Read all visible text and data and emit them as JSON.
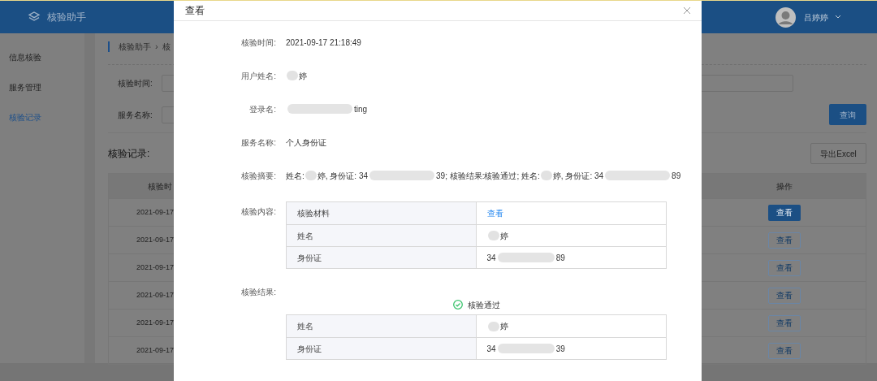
{
  "app": {
    "title": "核验助手",
    "user": "吕婷婷",
    "sidebar": [
      {
        "label": "信息核验",
        "selected": false
      },
      {
        "label": "服务管理",
        "selected": false
      },
      {
        "label": "核验记录",
        "selected": true
      }
    ],
    "breadcrumb": [
      "核验助手",
      "核"
    ],
    "breadcrumb_separator": "›",
    "filters": [
      {
        "label": "核验时间:"
      },
      {
        "label": "服务名称:"
      }
    ],
    "query_button": "查询",
    "records_title": "核验记录:",
    "export_button": "导出Excel",
    "table": {
      "columns": [
        "核验时",
        "操作"
      ],
      "rows": [
        {
          "date": "2021-09-17",
          "action": "查看",
          "selected": true
        },
        {
          "date": "2021-09-17",
          "action": "查看",
          "selected": false
        },
        {
          "date": "2021-09-17",
          "action": "查看",
          "selected": false
        },
        {
          "date": "2021-09-17",
          "action": "查看",
          "selected": false
        },
        {
          "date": "2021-09-17",
          "action": "查看",
          "selected": false
        },
        {
          "date": "2021-09-17",
          "action": "查看",
          "selected": false
        }
      ]
    }
  },
  "dialog": {
    "title": "查看",
    "fields": [
      {
        "label": "核验时间:",
        "value": [
          {
            "kind": "text",
            "text": "2021-09-17 21:18:49"
          }
        ]
      },
      {
        "label": "用户姓名:",
        "value": [
          {
            "kind": "blur"
          },
          {
            "kind": "text",
            "text": "婷"
          }
        ]
      },
      {
        "label": "登录名:",
        "value": [
          {
            "kind": "blur-long"
          },
          {
            "kind": "text",
            "text": "ting"
          }
        ]
      },
      {
        "label": "服务名称:",
        "value": [
          {
            "kind": "text",
            "text": "个人身份证"
          }
        ]
      },
      {
        "label": "核验摘要:",
        "value": [
          {
            "kind": "text",
            "text": "姓名:"
          },
          {
            "kind": "blur"
          },
          {
            "kind": "text",
            "text": "婷, 身份证: 34"
          },
          {
            "kind": "blur-long"
          },
          {
            "kind": "text",
            "text": "39; 核验结果:核验通过; 姓名:"
          },
          {
            "kind": "blur"
          },
          {
            "kind": "text",
            "text": "婷, 身份证: 34"
          },
          {
            "kind": "blur-long"
          },
          {
            "kind": "text",
            "text": "89"
          }
        ]
      }
    ],
    "content": {
      "label": "核验内容:",
      "rows": [
        {
          "label": "核验材料",
          "value": [
            {
              "kind": "link",
              "text": "查看"
            }
          ]
        },
        {
          "label": "姓名",
          "value": [
            {
              "kind": "blur"
            },
            {
              "kind": "text",
              "text": "婷"
            }
          ]
        },
        {
          "label": "身份证",
          "value": [
            {
              "kind": "text",
              "text": "34"
            },
            {
              "kind": "blur-long"
            },
            {
              "kind": "text",
              "text": "89"
            }
          ]
        }
      ]
    },
    "result": {
      "label": "核验结果:",
      "status": "核验通过",
      "passed": true,
      "rows": [
        {
          "label": "姓名",
          "value": [
            {
              "kind": "blur"
            },
            {
              "kind": "text",
              "text": "婷"
            }
          ]
        },
        {
          "label": "身份证",
          "value": [
            {
              "kind": "text",
              "text": "34"
            },
            {
              "kind": "blur-long"
            },
            {
              "kind": "text",
              "text": "39"
            }
          ]
        }
      ]
    }
  }
}
